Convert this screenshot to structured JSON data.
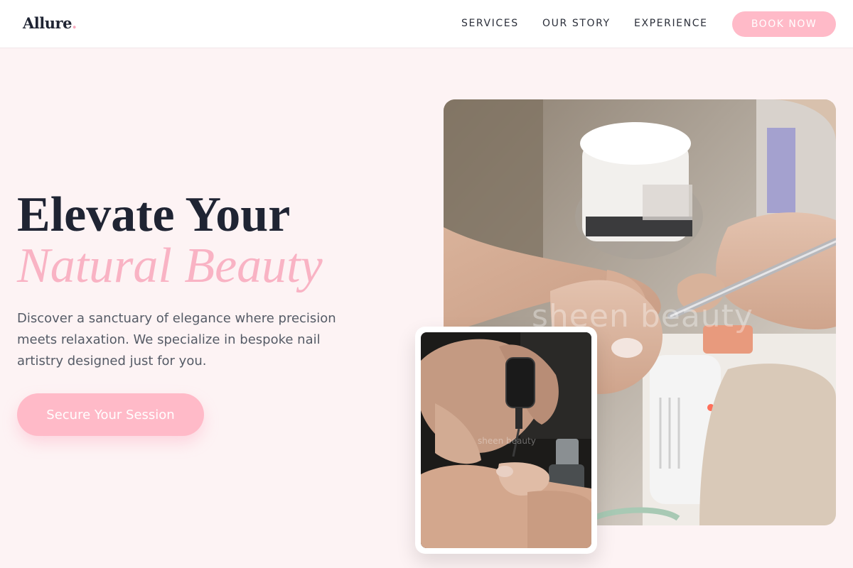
{
  "brand": {
    "name": "Allure",
    "dot": "."
  },
  "nav": {
    "items": [
      {
        "label": "SERVICES"
      },
      {
        "label": "OUR STORY"
      },
      {
        "label": "EXPERIENCE"
      }
    ],
    "cta_label": "BOOK NOW"
  },
  "hero": {
    "title_line1": "Elevate Your",
    "title_line2": "Natural Beauty",
    "description": "Discover a sanctuary of elegance where precision meets relaxation. We specialize in bespoke nail artistry designed just for you.",
    "cta_label": "Secure Your Session"
  },
  "images": {
    "main": {
      "watermark": "sheen beauty"
    },
    "inset": {
      "watermark": "sheen beauty"
    }
  },
  "colors": {
    "accent": "#ffbac8",
    "accent_text": "#f9b3c4",
    "page_bg": "#fdf3f4",
    "heading": "#1f2433"
  }
}
